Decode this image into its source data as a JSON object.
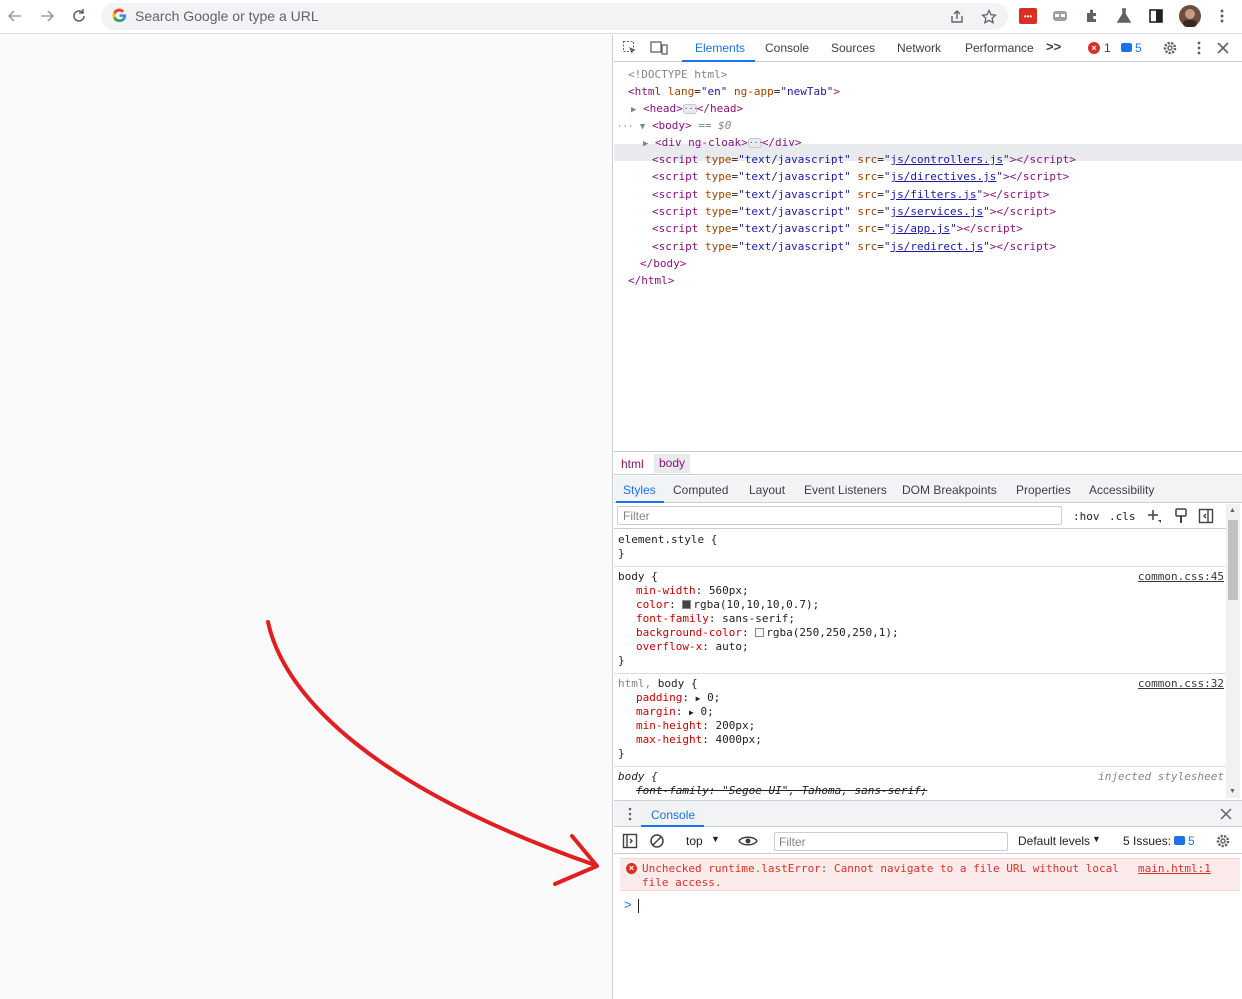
{
  "browser": {
    "omnibox_placeholder": "Search Google or type a URL"
  },
  "devtools": {
    "tabs": [
      "Elements",
      "Console",
      "Sources",
      "Network",
      "Performance"
    ],
    "more_tabs_label": ">>",
    "error_count": "1",
    "message_count": "5",
    "dom": {
      "doctype": "<!DOCTYPE html>",
      "html_open": {
        "tag": "html",
        "attrs": [
          {
            "name": "lang",
            "value": "en"
          },
          {
            "name": "ng-app",
            "value": "newTab"
          }
        ]
      },
      "head": {
        "open": "<head>",
        "close": "</head>"
      },
      "body_open": "<body>",
      "body_marker": "== $0",
      "div": {
        "open": "<div ng-cloak>",
        "close": "</div>"
      },
      "scripts": [
        {
          "type": "text/javascript",
          "src": "js/controllers.js"
        },
        {
          "type": "text/javascript",
          "src": "js/directives.js"
        },
        {
          "type": "text/javascript",
          "src": "js/filters.js"
        },
        {
          "type": "text/javascript",
          "src": "js/services.js"
        },
        {
          "type": "text/javascript",
          "src": "js/app.js"
        },
        {
          "type": "text/javascript",
          "src": "js/redirect.js"
        }
      ],
      "body_close": "</body>",
      "html_close": "</html>"
    },
    "breadcrumb": [
      "html",
      "body"
    ],
    "styles_tabs": [
      "Styles",
      "Computed",
      "Layout",
      "Event Listeners",
      "DOM Breakpoints",
      "Properties",
      "Accessibility"
    ],
    "styles_filter_placeholder": "Filter",
    "hov_label": ":hov",
    "cls_label": ".cls",
    "rules": {
      "element_style": {
        "selector": "element.style {",
        "close": "}"
      },
      "body_rule": {
        "selector": "body {",
        "source": "common.css:45",
        "props": [
          {
            "name": "min-width",
            "value": "560px;"
          },
          {
            "name": "color",
            "value": "rgba(10,10,10,0.7);",
            "swatch": "#444444"
          },
          {
            "name": "font-family",
            "value": "sans-serif;"
          },
          {
            "name": "background-color",
            "value": "rgba(250,250,250,1);",
            "swatch": "#fafafa"
          },
          {
            "name": "overflow-x",
            "value": "auto;"
          }
        ],
        "close": "}"
      },
      "html_body_rule": {
        "selector_dim": "html,",
        "selector": "body {",
        "source": "common.css:32",
        "props": [
          {
            "name": "padding",
            "value": "0;"
          },
          {
            "name": "margin",
            "value": "0;"
          },
          {
            "name": "min-height",
            "value": "200px;"
          },
          {
            "name": "max-height",
            "value": "4000px;"
          }
        ],
        "close": "}"
      },
      "injected_rule": {
        "selector": "body {",
        "source": "injected stylesheet",
        "struck_prop": "font-family: \"Segoe UI\", Tahoma, sans-serif;"
      }
    },
    "console": {
      "title": "Console",
      "context": "top",
      "filter_placeholder": "Filter",
      "levels": "Default levels",
      "issues_label": "5 Issues:",
      "issues_count": "5",
      "error_message": "Unchecked runtime.lastError: Cannot navigate to a file URL without local file access.",
      "error_source": "main.html:1",
      "prompt": ">"
    }
  },
  "colors": {
    "accent": "#1a73e8",
    "error": "#d93025",
    "annotation_arrow": "#e02020"
  }
}
